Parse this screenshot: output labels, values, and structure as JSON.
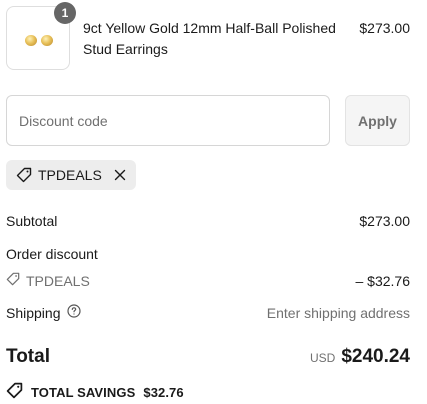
{
  "cart_item": {
    "quantity": "1",
    "name": "9ct Yellow Gold 12mm Half-Ball Polished Stud Earrings",
    "price": "$273.00"
  },
  "discount": {
    "placeholder": "Discount code",
    "apply_label": "Apply",
    "applied_code": "TPDEALS"
  },
  "summary": {
    "subtotal_label": "Subtotal",
    "subtotal_value": "$273.00",
    "order_discount_label": "Order discount",
    "discount_code": "TPDEALS",
    "discount_value": "– $32.76",
    "shipping_label": "Shipping",
    "shipping_value": "Enter shipping address",
    "total_label": "Total",
    "currency": "USD",
    "total_value": "$240.24",
    "savings_label": "TOTAL SAVINGS",
    "savings_value": "$32.76"
  },
  "colors": {
    "text": "#1a1a1a",
    "muted": "#707070",
    "chip_bg": "#ededed",
    "badge_bg": "#666666",
    "gold": "#d9b04a"
  },
  "icons": [
    "product-thumbnail",
    "tag-icon",
    "close-icon",
    "help-circle-icon",
    "savings-tag-icon"
  ]
}
